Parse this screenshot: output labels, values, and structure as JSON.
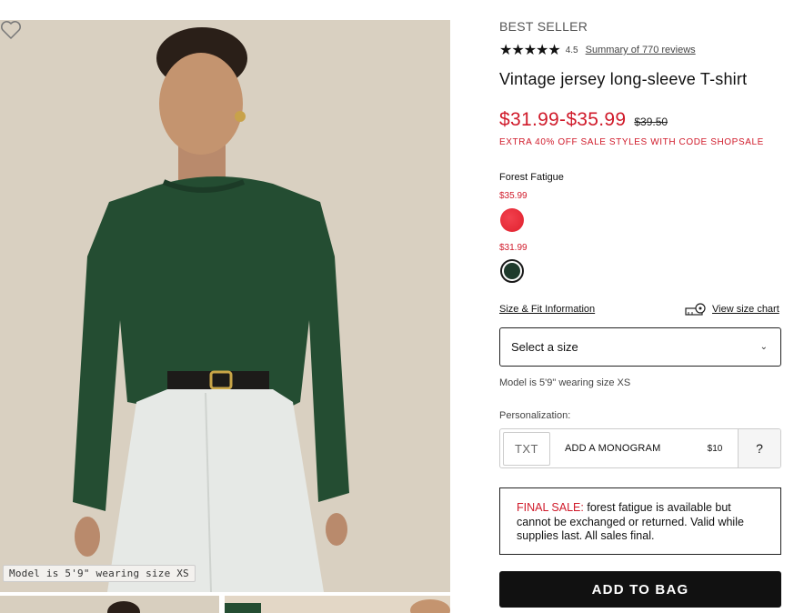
{
  "gallery": {
    "model_caption": "Model is 5'9\" wearing size XS",
    "favorite_icon": "heart-outline-icon"
  },
  "product": {
    "badge": "BEST SELLER",
    "stars": "★★★★★",
    "rating": "4.5",
    "reviews_link": "Summary of 770 reviews",
    "title": "Vintage jersey long-sleeve T-shirt",
    "price_range": "$31.99-$35.99",
    "original_price": "$39.50",
    "promo": "EXTRA 40% OFF SALE STYLES WITH CODE SHOPSALE",
    "color_name": "Forest Fatigue",
    "swatches": [
      {
        "price": "$35.99",
        "color": "#e8282f"
      },
      {
        "price": "$31.99",
        "color": "#1f3a2c"
      }
    ],
    "size_fit_link": "Size & Fit Information",
    "size_chart_link": "View size chart",
    "size_select": "Select a size",
    "model_note": "Model is 5'9\" wearing size XS",
    "personalization_label": "Personalization:",
    "monogram": {
      "tile": "TXT",
      "label": "ADD A MONOGRAM",
      "price": "$10",
      "help": "?"
    },
    "final_sale": {
      "prefix": "FINAL SALE:",
      "text": " forest fatigue is available but cannot be exchanged or returned. Valid while supplies last. All sales final."
    },
    "add_to_bag": "ADD TO BAG"
  },
  "colors": {
    "sale_red": "#d01a2a",
    "accent_black": "#111111"
  }
}
